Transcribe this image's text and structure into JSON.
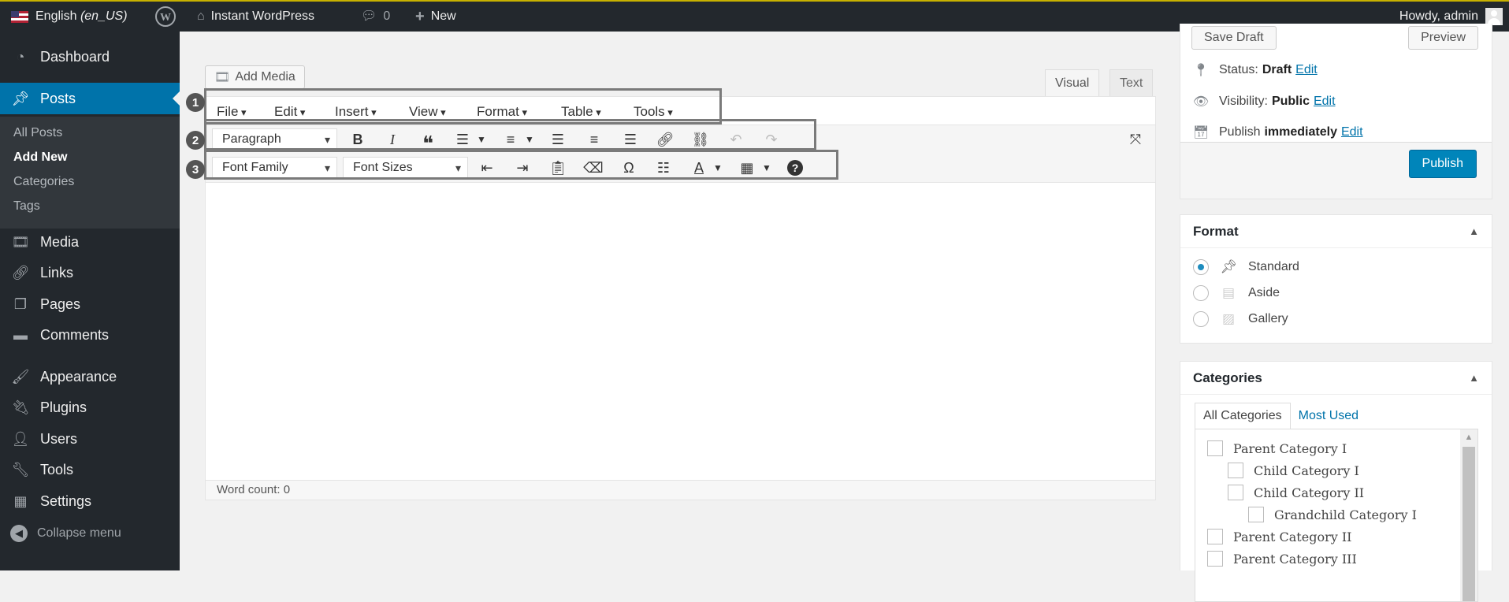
{
  "adminbar": {
    "language": "English",
    "language_code": "(en_US)",
    "site_name": "Instant WordPress",
    "comments_count": "0",
    "new_label": "New",
    "howdy": "Howdy, admin"
  },
  "sidebar": {
    "items": [
      {
        "label": "Dashboard",
        "icon": "dashboard-icon"
      },
      {
        "label": "Posts",
        "icon": "pushpin-icon"
      },
      {
        "label": "Media",
        "icon": "media-icon"
      },
      {
        "label": "Links",
        "icon": "link-icon"
      },
      {
        "label": "Pages",
        "icon": "pages-icon"
      },
      {
        "label": "Comments",
        "icon": "comments-icon"
      },
      {
        "label": "Appearance",
        "icon": "brush-icon"
      },
      {
        "label": "Plugins",
        "icon": "plugin-icon"
      },
      {
        "label": "Users",
        "icon": "users-icon"
      },
      {
        "label": "Tools",
        "icon": "wrench-icon"
      },
      {
        "label": "Settings",
        "icon": "settings-icon"
      }
    ],
    "submenu": [
      "All Posts",
      "Add New",
      "Categories",
      "Tags"
    ],
    "collapse": "Collapse menu"
  },
  "editor": {
    "add_media": "Add Media",
    "tab_visual": "Visual",
    "tab_text": "Text",
    "menubar": [
      "File",
      "Edit",
      "Insert",
      "View",
      "Format",
      "Table",
      "Tools"
    ],
    "format_select": "Paragraph",
    "font_family": "Font Family",
    "font_sizes": "Font Sizes",
    "word_count": "Word count: 0",
    "callouts": [
      "1",
      "2",
      "3"
    ]
  },
  "publish": {
    "save_draft": "Save Draft",
    "preview": "Preview",
    "status_label": "Status:",
    "status_value": "Draft",
    "visibility_label": "Visibility:",
    "visibility_value": "Public",
    "publish_label": "Publish",
    "publish_value": "immediately",
    "edit": "Edit",
    "publish_button": "Publish"
  },
  "format_box": {
    "title": "Format",
    "options": [
      "Standard",
      "Aside",
      "Gallery"
    ],
    "selected": "Standard"
  },
  "categories_box": {
    "title": "Categories",
    "tab_all": "All Categories",
    "tab_used": "Most Used",
    "items": [
      "Parent Category I",
      "Child Category I",
      "Child Category II",
      "Grandchild Category I",
      "Parent Category II",
      "Parent Category III"
    ]
  },
  "colors": {
    "admin_bar": "#23282d",
    "active_menu": "#0073aa",
    "publish_button": "#0085ba",
    "link": "#0073aa"
  }
}
